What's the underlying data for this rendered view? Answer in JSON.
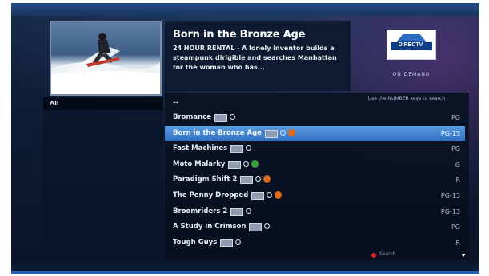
{
  "info": {
    "title": "Born in the Bronze Age",
    "description": "24 HOUR RENTAL - A lonely inventor builds a steampunk dirigible and searches Manhattan for the woman who has..."
  },
  "brand": {
    "logo_text": "DIRECTV",
    "subtitle": "ON DEMAND"
  },
  "categories": [
    "All"
  ],
  "list": {
    "hint": "Use the NUMBER keys to search",
    "header_dash": "--",
    "rows": [
      {
        "title": "Bromance",
        "rating": "PG",
        "status": "none",
        "selected": false
      },
      {
        "title": "Born in the Bronze Age",
        "rating": "PG-13",
        "status": "orange",
        "selected": true
      },
      {
        "title": "Fast Machines",
        "rating": "PG",
        "status": "none",
        "selected": false
      },
      {
        "title": "Moto Malarky",
        "rating": "G",
        "status": "green",
        "selected": false
      },
      {
        "title": "Paradigm Shift 2",
        "rating": "R",
        "status": "orange",
        "selected": false
      },
      {
        "title": "The Penny Dropped",
        "rating": "PG-13",
        "status": "orange",
        "selected": false
      },
      {
        "title": "Broomriders 2",
        "rating": "PG-13",
        "status": "none",
        "selected": false
      },
      {
        "title": "A Study in Crimson",
        "rating": "PG",
        "status": "none",
        "selected": false
      },
      {
        "title": "Tough Guys",
        "rating": "R",
        "status": "none",
        "selected": false
      }
    ],
    "search_label": "Search"
  },
  "colors": {
    "selected_row": "#3f82d3",
    "status_orange": "#e06a1a",
    "status_green": "#3aa63a",
    "search_red": "#d42626"
  }
}
